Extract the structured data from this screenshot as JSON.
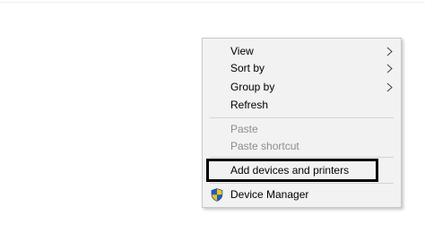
{
  "context_menu": {
    "items": [
      {
        "label": "View",
        "has_submenu": true,
        "enabled": true
      },
      {
        "label": "Sort by",
        "has_submenu": true,
        "enabled": true
      },
      {
        "label": "Group by",
        "has_submenu": true,
        "enabled": true
      },
      {
        "label": "Refresh",
        "has_submenu": false,
        "enabled": true
      },
      {
        "label": "Paste",
        "has_submenu": false,
        "enabled": false
      },
      {
        "label": "Paste shortcut",
        "has_submenu": false,
        "enabled": false
      },
      {
        "label": "Add devices and printers",
        "has_submenu": false,
        "enabled": true,
        "highlighted": true
      },
      {
        "label": "Device Manager",
        "has_submenu": false,
        "enabled": true,
        "icon": "uac-shield-icon"
      }
    ]
  },
  "colors": {
    "menu_background": "#f2f2f2",
    "disabled_text": "#8c8c8c",
    "highlight_border": "#000000",
    "shield_blue": "#1f5fbf",
    "shield_yellow": "#f2c21a"
  }
}
